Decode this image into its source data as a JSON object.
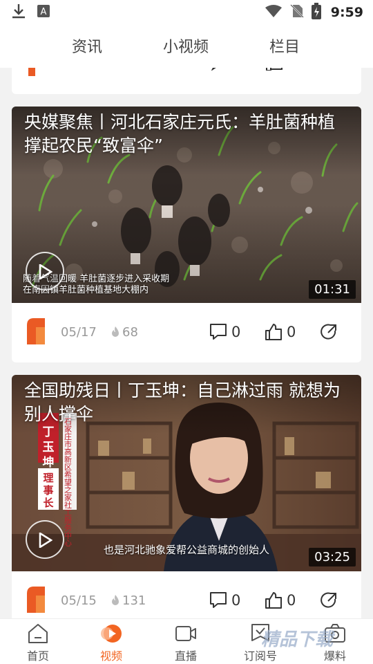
{
  "status_bar": {
    "time": "9:59",
    "left_icons": [
      "download-icon",
      "notification-a-icon"
    ],
    "right_icons": [
      "wifi-icon",
      "no-sim-icon",
      "battery-charging-icon"
    ]
  },
  "top_tabs": [
    "资讯",
    "小视频",
    "栏目"
  ],
  "cards": [
    {
      "title": "央媒聚焦丨河北石家庄元氏：羊肚菌种植撑起农民“致富伞”",
      "caption_lines": [
        "随着气温回暖 羊肚菌逐步进入采收期",
        "在南因镇羊肚菌种植基地大棚内"
      ],
      "duration": "01:31",
      "date": "05/17",
      "heat": "68",
      "comments": "0",
      "likes": "0"
    },
    {
      "title": "全国助残日丨丁玉坤：自己淋过雨 就想为别人撑伞",
      "caption_lines": [
        "也是河北驰象爱帮公益商城的创始人"
      ],
      "name_tag": [
        "丁",
        "玉",
        "坤"
      ],
      "role_tag": [
        "理",
        "事",
        "长"
      ],
      "org_tag": "石家庄市高新区希望之家社工服务中心",
      "duration": "03:25",
      "date": "05/15",
      "heat": "131",
      "comments": "0",
      "likes": "0"
    }
  ],
  "bottom_nav": [
    {
      "label": "首页",
      "icon": "home-icon"
    },
    {
      "label": "视频",
      "icon": "video-icon"
    },
    {
      "label": "直播",
      "icon": "live-camera-icon"
    },
    {
      "label": "订阅号",
      "icon": "subscribe-icon"
    },
    {
      "label": "爆料",
      "icon": "camera-report-icon"
    }
  ],
  "watermark": "精品下载",
  "colors": {
    "accent": "#f26522",
    "card_bg": "#ffffff",
    "page_bg": "#f2f2f2"
  }
}
